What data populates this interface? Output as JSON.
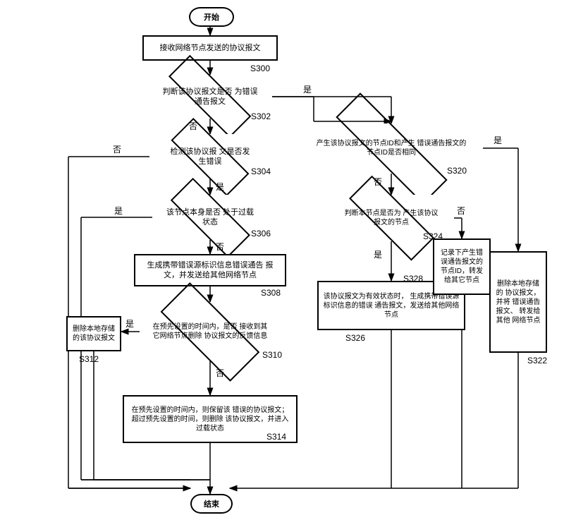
{
  "chart_data": {
    "type": "flowchart",
    "title": "",
    "nodes": [
      {
        "id": "start",
        "type": "terminator",
        "text": "开始"
      },
      {
        "id": "p300",
        "type": "process",
        "text": "接收网络节点发送的协议报文",
        "ref": "S300"
      },
      {
        "id": "d302",
        "type": "decision",
        "text": "判断该协议报文是否为错误通告报文",
        "ref": "S302"
      },
      {
        "id": "d304",
        "type": "decision",
        "text": "检测该协议报文是否发生错误",
        "ref": "S304"
      },
      {
        "id": "d306",
        "type": "decision",
        "text": "该节点本身是否处于过载状态",
        "ref": "S306"
      },
      {
        "id": "p308",
        "type": "process",
        "text": "生成携带错误源标识信息错误通告报文，并发送给其他网络节点",
        "ref": "S308"
      },
      {
        "id": "d310",
        "type": "decision",
        "text": "在预先设置的时间内，是否接收到其它网络节点删除协议报文的反馈信息",
        "ref": "S310"
      },
      {
        "id": "p312",
        "type": "process",
        "text": "删除本地存储的该协议报文",
        "ref": "S312"
      },
      {
        "id": "p314",
        "type": "process",
        "text": "在预先设置的时间内，则保留该错误的协议报文；超过预先设置的时间，则删除该协议报文，并进入过载状态",
        "ref": "S314"
      },
      {
        "id": "d320",
        "type": "decision",
        "text": "产生该协议报文的节点ID和产生错误通告报文的节点ID是否相同",
        "ref": "S320"
      },
      {
        "id": "p322",
        "type": "process",
        "text": "删除本地存储的协议报文，并将错误通告报文、转发给其他网络节点",
        "ref": "S322"
      },
      {
        "id": "d324",
        "type": "decision",
        "text": "判断本节点是否为产生该协议报文的节点",
        "ref": "S324"
      },
      {
        "id": "p326",
        "type": "process",
        "text": "该协议报文为有效状态时，生成携带错误源标识信息的错误通告报文，发送给其他网络节点",
        "ref": "S326"
      },
      {
        "id": "p328",
        "type": "process",
        "text": "记录下产生错误通告报文的节点ID，转发给其它节点",
        "ref": "S328"
      },
      {
        "id": "end",
        "type": "terminator",
        "text": "结束"
      }
    ],
    "edges": [
      {
        "from": "start",
        "to": "p300"
      },
      {
        "from": "p300",
        "to": "d302"
      },
      {
        "from": "d302",
        "to": "d304",
        "label": "否"
      },
      {
        "from": "d302",
        "to": "d320",
        "label": "是"
      },
      {
        "from": "d304",
        "to": "end",
        "label": "否"
      },
      {
        "from": "d304",
        "to": "d306",
        "label": "是"
      },
      {
        "from": "d306",
        "to": "end",
        "label": "是"
      },
      {
        "from": "d306",
        "to": "p308",
        "label": "否"
      },
      {
        "from": "p308",
        "to": "d310"
      },
      {
        "from": "d310",
        "to": "p312",
        "label": "是"
      },
      {
        "from": "d310",
        "to": "p314",
        "label": "否"
      },
      {
        "from": "p312",
        "to": "end"
      },
      {
        "from": "p314",
        "to": "end"
      },
      {
        "from": "d320",
        "to": "p322",
        "label": "是"
      },
      {
        "from": "d320",
        "to": "d324",
        "label": "否"
      },
      {
        "from": "d324",
        "to": "p326",
        "label": "是"
      },
      {
        "from": "d324",
        "to": "p328",
        "label": "否"
      },
      {
        "from": "p326",
        "to": "end"
      },
      {
        "from": "p328",
        "to": "end"
      },
      {
        "from": "p322",
        "to": "end"
      }
    ]
  },
  "labels": {
    "start": "开始",
    "end": "结束",
    "p300": "接收网络节点发送的协议报文",
    "d302": "判断该协议报文是否\n为错误通告报文",
    "d304": "检测该协议报\n文是否发生错误",
    "d306": "该节点本身是否\n处于过载状态",
    "p308": "生成携带错误源标识信息错误通告\n报文，并发送给其他网络节点",
    "d310": "在预先设置的时间内，是否\n接收到其它网络节点删除\n协议报文的反馈信息",
    "p312": "删除本地存储\n的该协议报文",
    "p314": "在预先设置的时间内，则保留该\n错误的协议报文；超过预先设置的时间，则删除\n该协议报文，并进入过载状态",
    "d320": "产生该协议报文的节点ID和产生\n错误通告报文的节点ID是否相同",
    "p322": "删除本地存储的\n协议报文，并将\n错误通告报文、\n转发给其他\n网络节点",
    "d324": "判断本节点是否为\n产生该协议报文的节点",
    "p326": "该协议报文为有效状态时，\n生成携带错误源标识信息的错误\n通告报文，发送给其他网络节点",
    "p328": "记录下产生错\n误通告报文的\n节点ID，转发\n给其它节点"
  },
  "refs": {
    "s300": "S300",
    "s302": "S302",
    "s304": "S304",
    "s306": "S306",
    "s308": "S308",
    "s310": "S310",
    "s312": "S312",
    "s314": "S314",
    "s320": "S320",
    "s322": "S322",
    "s324": "S324",
    "s326": "S326",
    "s328": "S328"
  },
  "yn": {
    "yes": "是",
    "no": "否"
  }
}
